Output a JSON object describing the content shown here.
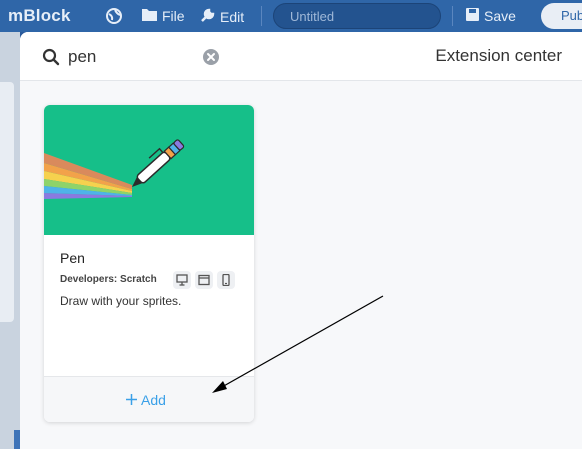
{
  "app": {
    "logo": "mBlock",
    "menu": [
      {
        "icon": "globe-icon",
        "label": ""
      },
      {
        "icon": "folder-icon",
        "label": "File"
      },
      {
        "icon": "wrench-icon",
        "label": "Edit"
      }
    ],
    "project_title": "Untitled",
    "save_label": "Save",
    "publish_label": "Pub"
  },
  "modal": {
    "search": {
      "value": "pen",
      "placeholder": ""
    },
    "title": "Extension center"
  },
  "extensions": [
    {
      "name": "Pen",
      "developer": "Developers: Scratch",
      "devices": [
        "desktop-icon",
        "window-icon",
        "mobile-icon"
      ],
      "description": "Draw with your sprites.",
      "add_label": "Add"
    }
  ],
  "colors": {
    "topbar": "#2f66a8",
    "banner": "#16bf89",
    "accent": "#3aa0e8"
  }
}
